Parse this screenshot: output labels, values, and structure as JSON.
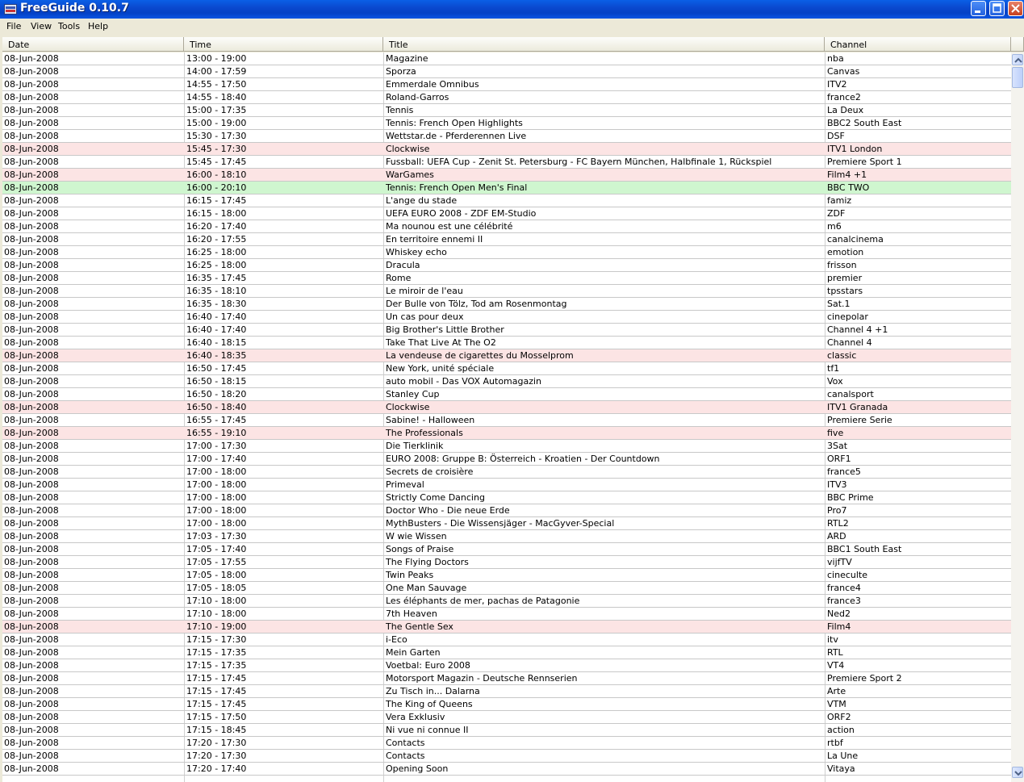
{
  "window": {
    "title": "FreeGuide 0.10.7"
  },
  "menu": [
    "File",
    "View",
    "Tools",
    "Help"
  ],
  "columns": [
    "Date",
    "Time",
    "Title",
    "Channel"
  ],
  "colors": {
    "highlight_red": "#fce4e4",
    "highlight_green": "#cff6cf"
  },
  "rows": [
    {
      "date": "08-Jun-2008",
      "time": "13:00 - 19:00",
      "title": "Magazine",
      "channel": "nba",
      "hl": ""
    },
    {
      "date": "08-Jun-2008",
      "time": "14:00 - 17:59",
      "title": "Sporza",
      "channel": "Canvas",
      "hl": ""
    },
    {
      "date": "08-Jun-2008",
      "time": "14:55 - 17:50",
      "title": "Emmerdale Omnibus",
      "channel": "ITV2",
      "hl": ""
    },
    {
      "date": "08-Jun-2008",
      "time": "14:55 - 18:40",
      "title": "Roland-Garros",
      "channel": "france2",
      "hl": ""
    },
    {
      "date": "08-Jun-2008",
      "time": "15:00 - 17:35",
      "title": "Tennis",
      "channel": "La Deux",
      "hl": ""
    },
    {
      "date": "08-Jun-2008",
      "time": "15:00 - 19:00",
      "title": "Tennis: French Open Highlights",
      "channel": "BBC2 South East",
      "hl": ""
    },
    {
      "date": "08-Jun-2008",
      "time": "15:30 - 17:30",
      "title": "Wettstar.de - Pferderennen Live",
      "channel": "DSF",
      "hl": ""
    },
    {
      "date": "08-Jun-2008",
      "time": "15:45 - 17:30",
      "title": "Clockwise",
      "channel": "ITV1 London",
      "hl": "pink"
    },
    {
      "date": "08-Jun-2008",
      "time": "15:45 - 17:45",
      "title": "Fussball: UEFA Cup - Zenit St. Petersburg - FC Bayern München, Halbfinale 1, Rückspiel",
      "channel": "Premiere Sport 1",
      "hl": ""
    },
    {
      "date": "08-Jun-2008",
      "time": "16:00 - 18:10",
      "title": "WarGames",
      "channel": "Film4 +1",
      "hl": "pink"
    },
    {
      "date": "08-Jun-2008",
      "time": "16:00 - 20:10",
      "title": "Tennis: French Open Men's Final",
      "channel": "BBC TWO",
      "hl": "green"
    },
    {
      "date": "08-Jun-2008",
      "time": "16:15 - 17:45",
      "title": "L'ange du stade",
      "channel": "famiz",
      "hl": ""
    },
    {
      "date": "08-Jun-2008",
      "time": "16:15 - 18:00",
      "title": "UEFA EURO 2008 - ZDF EM-Studio",
      "channel": "ZDF",
      "hl": ""
    },
    {
      "date": "08-Jun-2008",
      "time": "16:20 - 17:40",
      "title": "Ma nounou est une célébrité",
      "channel": "m6",
      "hl": ""
    },
    {
      "date": "08-Jun-2008",
      "time": "16:20 - 17:55",
      "title": "En territoire ennemi II",
      "channel": "canalcinema",
      "hl": ""
    },
    {
      "date": "08-Jun-2008",
      "time": "16:25 - 18:00",
      "title": "Whiskey echo",
      "channel": "emotion",
      "hl": ""
    },
    {
      "date": "08-Jun-2008",
      "time": "16:25 - 18:00",
      "title": "Dracula",
      "channel": "frisson",
      "hl": ""
    },
    {
      "date": "08-Jun-2008",
      "time": "16:35 - 17:45",
      "title": "Rome",
      "channel": "premier",
      "hl": ""
    },
    {
      "date": "08-Jun-2008",
      "time": "16:35 - 18:10",
      "title": "Le miroir de l'eau",
      "channel": "tpsstars",
      "hl": ""
    },
    {
      "date": "08-Jun-2008",
      "time": "16:35 - 18:30",
      "title": "Der Bulle von Tölz, Tod am Rosenmontag",
      "channel": "Sat.1",
      "hl": ""
    },
    {
      "date": "08-Jun-2008",
      "time": "16:40 - 17:40",
      "title": "Un cas pour deux",
      "channel": "cinepolar",
      "hl": ""
    },
    {
      "date": "08-Jun-2008",
      "time": "16:40 - 17:40",
      "title": "Big Brother's Little Brother",
      "channel": "Channel 4 +1",
      "hl": ""
    },
    {
      "date": "08-Jun-2008",
      "time": "16:40 - 18:15",
      "title": "Take That Live At The O2",
      "channel": "Channel 4",
      "hl": ""
    },
    {
      "date": "08-Jun-2008",
      "time": "16:40 - 18:35",
      "title": "La vendeuse de cigarettes du Mosselprom",
      "channel": "classic",
      "hl": "pink"
    },
    {
      "date": "08-Jun-2008",
      "time": "16:50 - 17:45",
      "title": "New York, unité spéciale",
      "channel": "tf1",
      "hl": ""
    },
    {
      "date": "08-Jun-2008",
      "time": "16:50 - 18:15",
      "title": "auto mobil - Das VOX Automagazin",
      "channel": "Vox",
      "hl": ""
    },
    {
      "date": "08-Jun-2008",
      "time": "16:50 - 18:20",
      "title": "Stanley Cup",
      "channel": "canalsport",
      "hl": ""
    },
    {
      "date": "08-Jun-2008",
      "time": "16:50 - 18:40",
      "title": "Clockwise",
      "channel": "ITV1 Granada",
      "hl": "pink"
    },
    {
      "date": "08-Jun-2008",
      "time": "16:55 - 17:45",
      "title": "Sabine! - Halloween",
      "channel": "Premiere Serie",
      "hl": ""
    },
    {
      "date": "08-Jun-2008",
      "time": "16:55 - 19:10",
      "title": "The Professionals",
      "channel": "five",
      "hl": "pink"
    },
    {
      "date": "08-Jun-2008",
      "time": "17:00 - 17:30",
      "title": "Die Tierklinik",
      "channel": "3Sat",
      "hl": ""
    },
    {
      "date": "08-Jun-2008",
      "time": "17:00 - 17:40",
      "title": "EURO 2008: Gruppe B: Österreich - Kroatien - Der Countdown",
      "channel": "ORF1",
      "hl": ""
    },
    {
      "date": "08-Jun-2008",
      "time": "17:00 - 18:00",
      "title": "Secrets de croisière",
      "channel": "france5",
      "hl": ""
    },
    {
      "date": "08-Jun-2008",
      "time": "17:00 - 18:00",
      "title": "Primeval",
      "channel": "ITV3",
      "hl": ""
    },
    {
      "date": "08-Jun-2008",
      "time": "17:00 - 18:00",
      "title": "Strictly Come Dancing",
      "channel": "BBC Prime",
      "hl": ""
    },
    {
      "date": "08-Jun-2008",
      "time": "17:00 - 18:00",
      "title": "Doctor Who - Die neue Erde",
      "channel": "Pro7",
      "hl": ""
    },
    {
      "date": "08-Jun-2008",
      "time": "17:00 - 18:00",
      "title": "MythBusters - Die Wissensjäger - MacGyver-Special",
      "channel": "RTL2",
      "hl": ""
    },
    {
      "date": "08-Jun-2008",
      "time": "17:03 - 17:30",
      "title": "W wie Wissen",
      "channel": "ARD",
      "hl": ""
    },
    {
      "date": "08-Jun-2008",
      "time": "17:05 - 17:40",
      "title": "Songs of Praise",
      "channel": "BBC1 South East",
      "hl": ""
    },
    {
      "date": "08-Jun-2008",
      "time": "17:05 - 17:55",
      "title": "The Flying Doctors",
      "channel": "vijfTV",
      "hl": ""
    },
    {
      "date": "08-Jun-2008",
      "time": "17:05 - 18:00",
      "title": "Twin Peaks",
      "channel": "cineculte",
      "hl": ""
    },
    {
      "date": "08-Jun-2008",
      "time": "17:05 - 18:05",
      "title": "One Man Sauvage",
      "channel": "france4",
      "hl": ""
    },
    {
      "date": "08-Jun-2008",
      "time": "17:10 - 18:00",
      "title": "Les éléphants de mer, pachas de Patagonie",
      "channel": "france3",
      "hl": ""
    },
    {
      "date": "08-Jun-2008",
      "time": "17:10 - 18:00",
      "title": "7th Heaven",
      "channel": "Ned2",
      "hl": ""
    },
    {
      "date": "08-Jun-2008",
      "time": "17:10 - 19:00",
      "title": "The Gentle Sex",
      "channel": "Film4",
      "hl": "pink"
    },
    {
      "date": "08-Jun-2008",
      "time": "17:15 - 17:30",
      "title": "i-Eco",
      "channel": "itv",
      "hl": ""
    },
    {
      "date": "08-Jun-2008",
      "time": "17:15 - 17:35",
      "title": "Mein Garten",
      "channel": "RTL",
      "hl": ""
    },
    {
      "date": "08-Jun-2008",
      "time": "17:15 - 17:35",
      "title": "Voetbal: Euro 2008",
      "channel": "VT4",
      "hl": ""
    },
    {
      "date": "08-Jun-2008",
      "time": "17:15 - 17:45",
      "title": "Motorsport Magazin - Deutsche Rennserien",
      "channel": "Premiere Sport 2",
      "hl": ""
    },
    {
      "date": "08-Jun-2008",
      "time": "17:15 - 17:45",
      "title": "Zu Tisch in... Dalarna",
      "channel": "Arte",
      "hl": ""
    },
    {
      "date": "08-Jun-2008",
      "time": "17:15 - 17:45",
      "title": "The King of Queens",
      "channel": "VTM",
      "hl": ""
    },
    {
      "date": "08-Jun-2008",
      "time": "17:15 - 17:50",
      "title": "Vera Exklusiv",
      "channel": "ORF2",
      "hl": ""
    },
    {
      "date": "08-Jun-2008",
      "time": "17:15 - 18:45",
      "title": "Ni vue ni connue II",
      "channel": "action",
      "hl": ""
    },
    {
      "date": "08-Jun-2008",
      "time": "17:20 - 17:30",
      "title": "Contacts",
      "channel": "rtbf",
      "hl": ""
    },
    {
      "date": "08-Jun-2008",
      "time": "17:20 - 17:30",
      "title": "Contacts",
      "channel": "La Une",
      "hl": ""
    },
    {
      "date": "08-Jun-2008",
      "time": "17:20 - 17:40",
      "title": "Opening Soon",
      "channel": "Vitaya",
      "hl": ""
    }
  ]
}
